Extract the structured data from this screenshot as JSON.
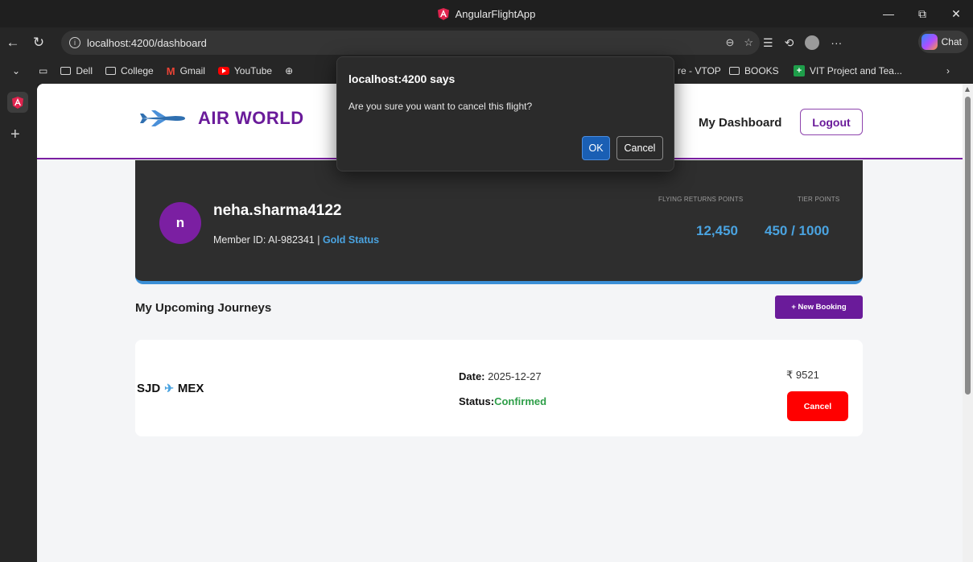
{
  "window": {
    "title": "AngularFlightApp"
  },
  "browser": {
    "url": "localhost:4200/dashboard",
    "chat_label": "Chat",
    "bookmarks": [
      {
        "label": "Dell",
        "icon": "folder-icon"
      },
      {
        "label": "College",
        "icon": "folder-icon"
      },
      {
        "label": "Gmail",
        "icon": "gmail-icon"
      },
      {
        "label": "YouTube",
        "icon": "youtube-icon"
      },
      {
        "label": "re - VTOP",
        "icon": "none"
      },
      {
        "label": "BOOKS",
        "icon": "folder-icon"
      },
      {
        "label": "VIT Project and Tea...",
        "icon": "vit-icon"
      }
    ]
  },
  "site": {
    "brand": "AIR WORLD",
    "nav_dashboard": "My Dashboard",
    "logout": "Logout"
  },
  "profile": {
    "initial": "n",
    "username": "neha.sharma4122",
    "member_prefix": "Member ID: AI-982341 | ",
    "status": "Gold Status",
    "points_label": "FLYING RETURNS POINTS",
    "points_value": "12,450",
    "tier_label": "TIER POINTS",
    "tier_value": "450 / 1000"
  },
  "journeys": {
    "title": "My Upcoming Journeys",
    "new_booking": "+ New Booking",
    "flights": [
      {
        "from": "SJD",
        "to": "MEX",
        "date_label": "Date:",
        "date": "2025-12-27",
        "status_label": "Status:",
        "status": "Confirmed",
        "price": "₹ 9521",
        "cancel": "Cancel"
      }
    ]
  },
  "dialog": {
    "title": "localhost:4200 says",
    "message": "Are you sure you want to cancel this flight?",
    "ok": "OK",
    "cancel": "Cancel"
  },
  "colors": {
    "brand_purple": "#6a1b9a",
    "accent_blue": "#4aa3e0",
    "confirmed_green": "#2e9e48",
    "cancel_red": "#ff0000"
  }
}
